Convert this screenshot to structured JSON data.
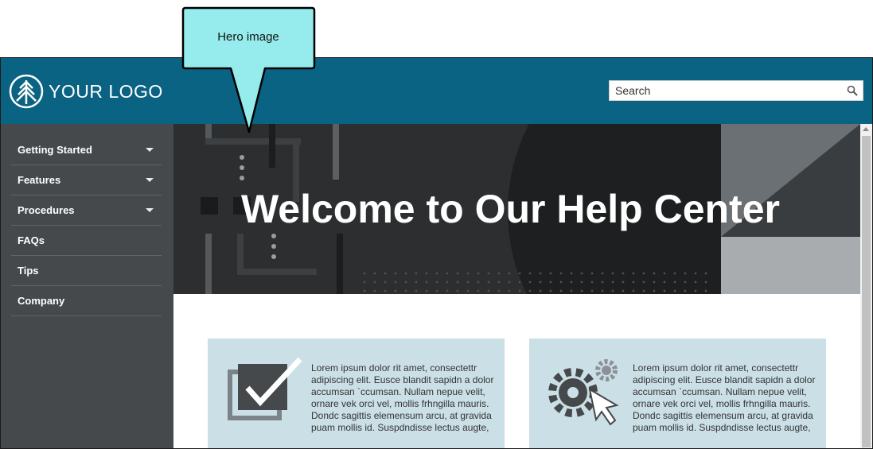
{
  "callout": {
    "label": "Hero image"
  },
  "header": {
    "logo_text": "YOUR LOGO",
    "search_placeholder": "Search"
  },
  "sidebar": {
    "items": [
      {
        "label": "Getting Started",
        "has_submenu": true
      },
      {
        "label": "Features",
        "has_submenu": true
      },
      {
        "label": "Procedures",
        "has_submenu": true
      },
      {
        "label": "FAQs",
        "has_submenu": false
      },
      {
        "label": "Tips",
        "has_submenu": false
      },
      {
        "label": "Company",
        "has_submenu": false
      }
    ]
  },
  "hero": {
    "title": "Welcome to Our Help Center"
  },
  "cards": [
    {
      "icon": "checkbox-icon",
      "text": "Lorem ipsum dolor rit amet, consectettr adipiscing elit. Eusce blandit sapidn a dolor accumsan `ccumsan. Nullam nepue velit, ornare vek orci vel, mollis frhngilla mauris. Dondc sagittis elemensum arcu, at gravida puam mollis id. Suspdndisse lectus augte,"
    },
    {
      "icon": "gears-cursor-icon",
      "text": "Lorem ipsum dolor rit amet, consectettr adipiscing elit. Eusce blandit sapidn a dolor accumsan `ccumsan. Nullam nepue velit, ornare vek orci vel, mollis frhngilla mauris. Dondc sagittis elemensum arcu, at gravida puam mollis id. Suspdndisse lectus augte,"
    }
  ],
  "colors": {
    "header_bg": "#0a6383",
    "sidebar_bg": "#45494b",
    "hero_bg": "#2c2e30",
    "card_bg": "#cbdfe6",
    "callout_bg": "#96ecec"
  }
}
